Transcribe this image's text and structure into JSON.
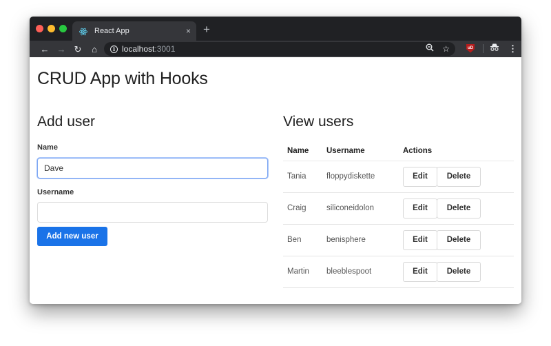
{
  "browser": {
    "tab_title": "React App",
    "tab_close_icon": "×",
    "new_tab_icon": "+",
    "url_host": "localhost",
    "url_port": ":3001",
    "nav": {
      "back": "←",
      "forward": "→",
      "reload": "↻",
      "home": "⌂"
    },
    "toolbar_icons": {
      "zoom": "zoom-out-icon",
      "bookmark": "☆",
      "ublock": "uD",
      "incognito": "incognito-icon",
      "menu": "⋮"
    }
  },
  "app": {
    "title": "CRUD App with Hooks",
    "add_user": {
      "heading": "Add user",
      "name_label": "Name",
      "name_value": "Dave",
      "username_label": "Username",
      "username_value": "",
      "submit_label": "Add new user"
    },
    "view_users": {
      "heading": "View users",
      "columns": [
        "Name",
        "Username",
        "Actions"
      ],
      "edit_label": "Edit",
      "delete_label": "Delete",
      "rows": [
        {
          "name": "Tania",
          "username": "floppydiskette"
        },
        {
          "name": "Craig",
          "username": "siliconeidolon"
        },
        {
          "name": "Ben",
          "username": "benisphere"
        },
        {
          "name": "Martin",
          "username": "bleeblespoot"
        }
      ]
    }
  },
  "colors": {
    "primary": "#1a73e8",
    "focus": "#7ea7f3",
    "chrome_dark": "#202124",
    "chrome_tab": "#35363a"
  }
}
